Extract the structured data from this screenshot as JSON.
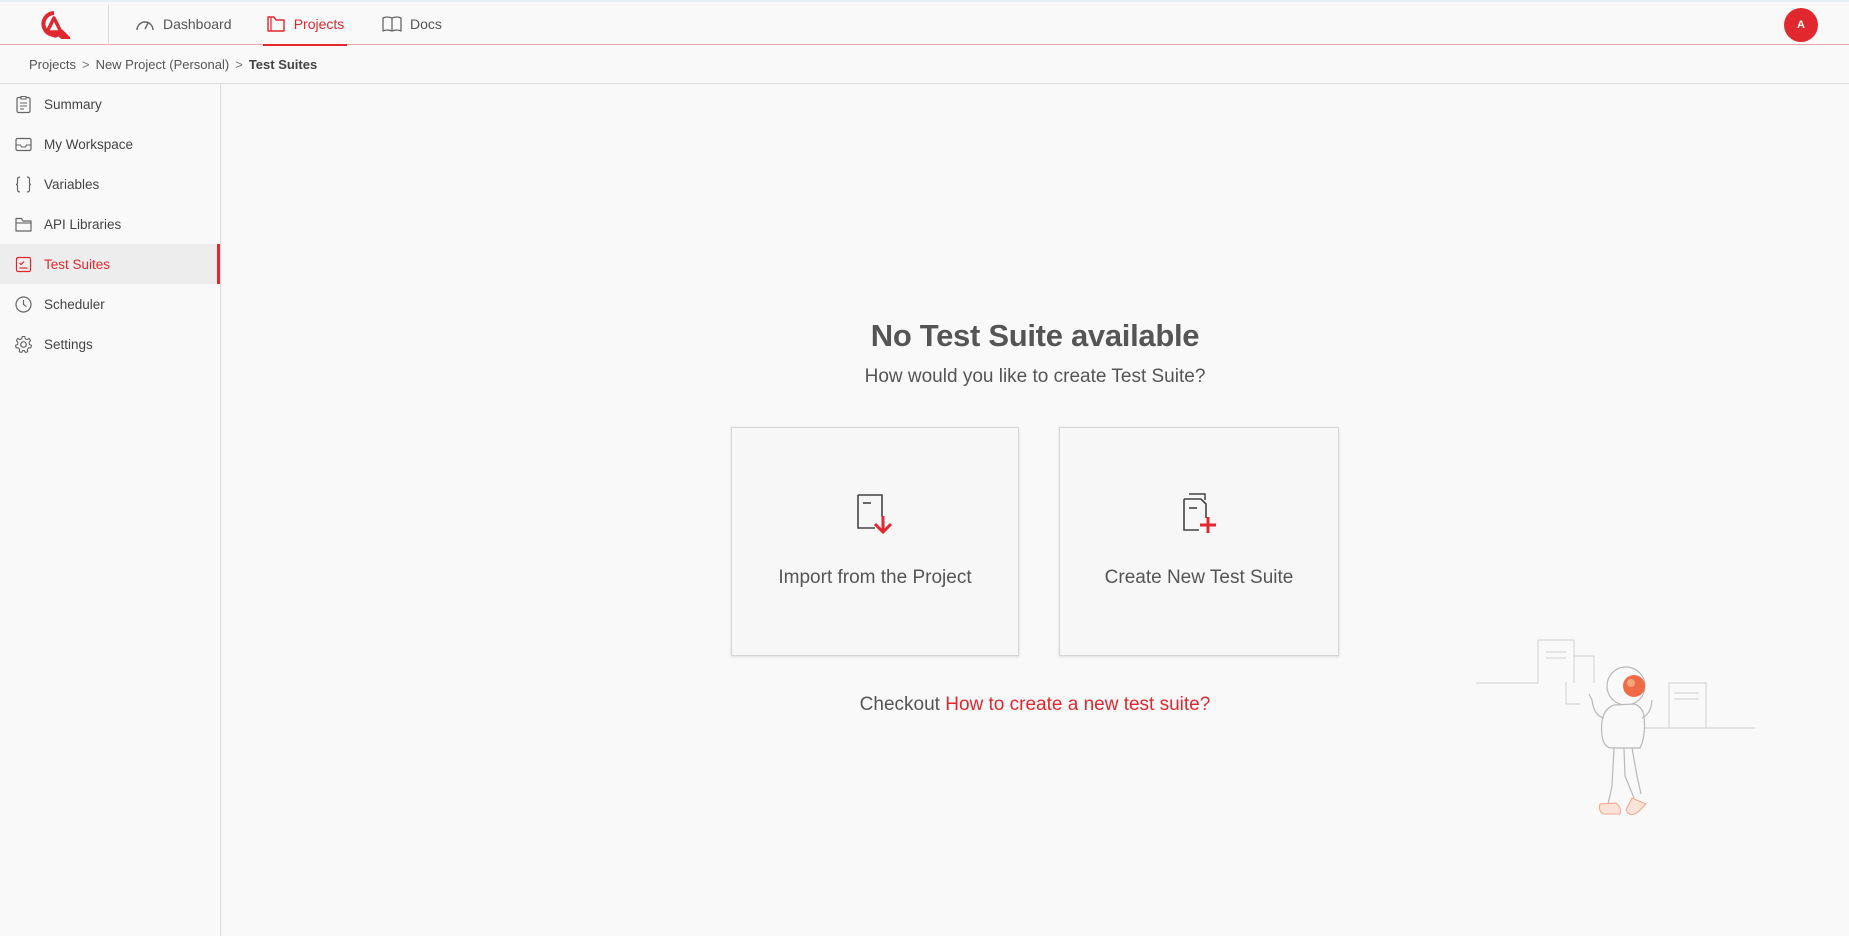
{
  "topbar": {
    "nav": [
      {
        "label": "Dashboard",
        "icon": "gauge-icon"
      },
      {
        "label": "Projects",
        "icon": "folder-icon",
        "active": true
      },
      {
        "label": "Docs",
        "icon": "book-icon"
      }
    ],
    "avatar_initial": "A"
  },
  "breadcrumb": {
    "items": [
      "Projects",
      "New Project (Personal)"
    ],
    "separator": ">",
    "current": "Test Suites"
  },
  "sidebar": {
    "items": [
      {
        "label": "Summary",
        "icon": "clipboard-icon"
      },
      {
        "label": "My Workspace",
        "icon": "inbox-icon"
      },
      {
        "label": "Variables",
        "icon": "braces-icon"
      },
      {
        "label": "API Libraries",
        "icon": "folder-icon"
      },
      {
        "label": "Test Suites",
        "icon": "checklist-icon",
        "active": true
      },
      {
        "label": "Scheduler",
        "icon": "clock-icon"
      },
      {
        "label": "Settings",
        "icon": "gear-icon"
      }
    ]
  },
  "empty_state": {
    "title": "No Test Suite available",
    "subtitle": "How would you like to create Test Suite?",
    "options": [
      {
        "label": "Import from the Project",
        "icon": "document-download-icon"
      },
      {
        "label": "Create New Test Suite",
        "icon": "document-add-icon"
      }
    ],
    "checkout_prefix": "Checkout",
    "checkout_link": "How to create a new test suite?"
  },
  "colors": {
    "accent": "#e0282e",
    "background": "#f9f9fa",
    "text": "#444444"
  }
}
